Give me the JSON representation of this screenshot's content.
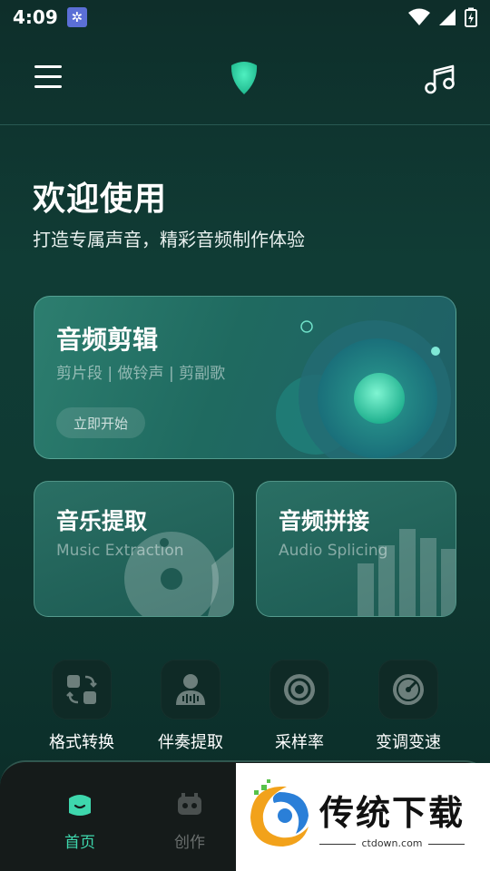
{
  "status_bar": {
    "time": "4:09"
  },
  "header": {
    "menu_icon": "hamburger-menu-icon",
    "logo_icon": "app-logo-icon",
    "music_icon": "music-note-icon"
  },
  "welcome": {
    "title": "欢迎使用",
    "subtitle": "打造专属声音，精彩音频制作体验"
  },
  "main_card": {
    "title": "音频剪辑",
    "subtitle": "剪片段 | 做铃声 | 剪副歌",
    "button_label": "立即开始"
  },
  "feature_cards": [
    {
      "title": "音乐提取",
      "subtitle": "Music Extraction"
    },
    {
      "title": "音频拼接",
      "subtitle": "Audio Splicing"
    }
  ],
  "tools": [
    {
      "label": "格式转换",
      "icon": "format-convert-icon"
    },
    {
      "label": "伴奏提取",
      "icon": "accompaniment-extract-icon"
    },
    {
      "label": "采样率",
      "icon": "sample-rate-icon"
    },
    {
      "label": "变调变速",
      "icon": "pitch-speed-icon"
    }
  ],
  "bottom_nav": [
    {
      "label": "首页",
      "active": true
    },
    {
      "label": "创作",
      "active": false
    }
  ],
  "watermark": {
    "text": "传统下载",
    "url": "ctdown.com"
  },
  "colors": {
    "accent": "#3ed7ad",
    "background": "#0f3a33",
    "nav_bg": "#151b1a"
  }
}
